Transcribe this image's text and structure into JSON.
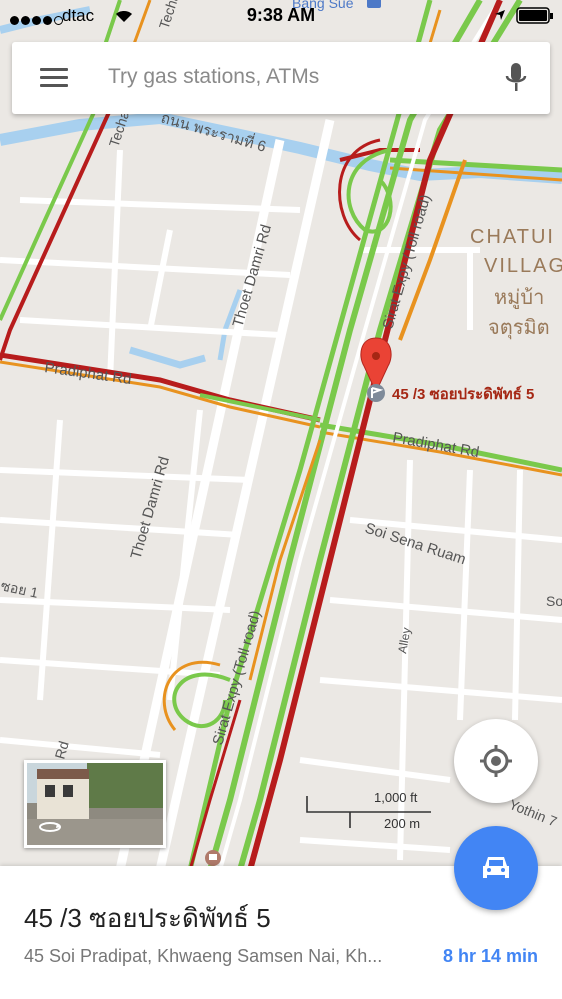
{
  "status_bar": {
    "carrier": "dtac",
    "time": "9:38 AM"
  },
  "search": {
    "placeholder": "Try gas stations, ATMs"
  },
  "map": {
    "labels": {
      "techa": "Techa",
      "techa_v": "Techa-V",
      "rama6": "ถนน พระรามที่ 6",
      "thoet_damri_1": "Thoet Damri Rd",
      "thoet_damri_2": "Thoet Damri Rd",
      "pradiphat_1": "Pradiphat Rd",
      "pradiphat_2": "Pradiphat Rd",
      "sirat_1": "Sirat Expy (Toll road)",
      "sirat_2": "Sirat Expy (Toll road)",
      "soi_sena_ruam": "Soi Sena Ruam",
      "alley": "Alley",
      "chatuchak_1": "CHATUI",
      "chatuchak_2": "VILLAG",
      "chatuchak_th1": "หมู่บ้า",
      "chatuchak_th2": "จตุรมิต",
      "bang_sue": "Bang Sue",
      "yothin": "Yothin 7",
      "left_edge": "ซอย 1",
      "rd": "Rd",
      "so": "So"
    },
    "pin_label": "45 /3 ซอยประดิพัทธ์ 5",
    "colors": {
      "heavy": "#b71c1c",
      "slow": "#e8921f",
      "free": "#7ac94b",
      "water": "#a8d0ef",
      "pin": "#ea4335"
    }
  },
  "scale": {
    "feet": "1,000 ft",
    "meters": "200 m"
  },
  "place": {
    "title": "45 /3 ซอยประดิพัทธ์ 5",
    "address": "45 Soi Pradipat, Khwaeng Samsen Nai, Kh...",
    "eta": "8 hr 14 min"
  }
}
